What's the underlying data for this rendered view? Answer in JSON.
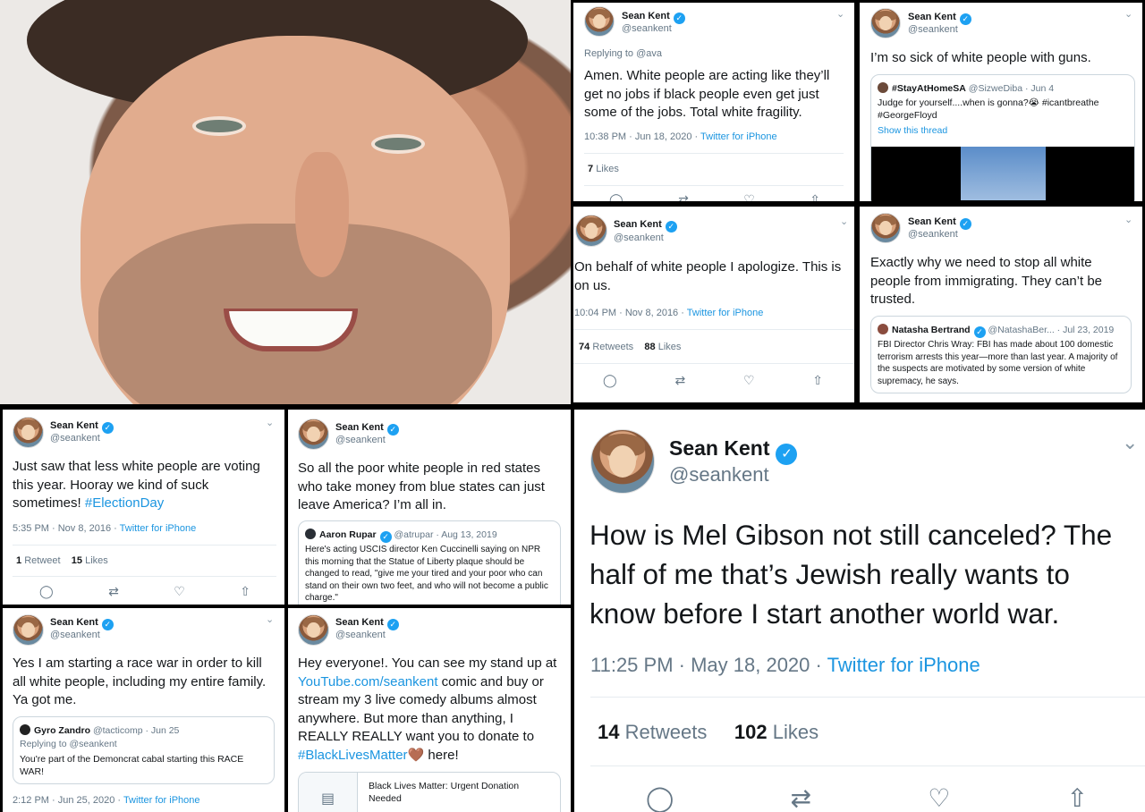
{
  "photo": {
    "alt_icon": "portrait-photo"
  },
  "t1": {
    "name": "Sean Kent",
    "handle": "@seankent",
    "reply": "Replying to @ava",
    "text": "Amen. White people are acting like they’ll get no jobs if black people even get just some of the jobs. Total white fragility.",
    "time": "10:38 PM · Jun 18, 2020 · ",
    "source": "Twitter for iPhone",
    "likes_num": "7",
    "likes_label": "Likes"
  },
  "t2": {
    "name": "Sean Kent",
    "handle": "@seankent",
    "text": "I’m so sick of white people with guns.",
    "quote": {
      "name": "#StayAtHomeSA",
      "handle": "@SizweDiba · Jun 4",
      "text": "Judge for yourself....when is gonna?😭 #icantbreathe #GeorgeFloyd",
      "show": "Show this thread"
    }
  },
  "t3": {
    "name": "Sean Kent",
    "handle": "@seankent",
    "text": "On behalf of white people I apologize. This is on us.",
    "time": "10:04 PM · Nov 8, 2016 · ",
    "source": "Twitter for iPhone",
    "rt_num": "74",
    "rt_label": "Retweets",
    "likes_num": "88",
    "likes_label": "Likes"
  },
  "t4": {
    "name": "Sean Kent",
    "handle": "@seankent",
    "text": "Exactly why we need to stop all white people from immigrating. They can’t be trusted.",
    "quote": {
      "name": "Natasha Bertrand",
      "handle": "@NatashaBer... · Jul 23, 2019",
      "text": "FBI Director Chris Wray: FBI has made about 100 domestic terrorism arrests this year—more than last year. A majority of the suspects are motivated by some version of white supremacy, he says."
    }
  },
  "t5": {
    "name": "Sean Kent",
    "handle": "@seankent",
    "text": "Just saw that less white people are voting this year. Hooray we kind of suck sometimes! ",
    "hashtag": "#ElectionDay",
    "time": "5:35 PM · Nov 8, 2016 · ",
    "source": "Twitter for iPhone",
    "rt_num": "1",
    "rt_label": "Retweet",
    "likes_num": "15",
    "likes_label": "Likes"
  },
  "t6": {
    "name": "Sean Kent",
    "handle": "@seankent",
    "text": "So all the poor white people in red states who take money from blue states can just leave America? I’m all in.",
    "quote": {
      "name": "Aaron Rupar",
      "handle": "@atrupar · Aug 13, 2019",
      "text": "Here's acting USCIS director Ken Cuccinelli saying on NPR this morning that the Statue of Liberty plaque should be changed to read, \"give me your tired and your poor who can stand on their own two feet, and who will not become a public charge.\""
    }
  },
  "t7": {
    "name": "Sean Kent",
    "handle": "@seankent",
    "text": "How is Mel Gibson not still canceled? The half of me that’s Jewish really wants to know before I start another world war.",
    "time": "11:25 PM · May 18, 2020 · ",
    "source": "Twitter for iPhone",
    "rt_num": "14",
    "rt_label": "Retweets",
    "likes_num": "102",
    "likes_label": "Likes"
  },
  "t8": {
    "name": "Sean Kent",
    "handle": "@seankent",
    "text": "Yes I am starting a race war in order to kill all white people, including my entire family. Ya got me.",
    "quote": {
      "name": "Gyro Zandro",
      "handle": "@tacticomp · Jun 25",
      "reply": "Replying to @seankent",
      "text": "You're part of the Demoncrat cabal starting this RACE WAR!"
    },
    "time": "2:12 PM · Jun 25, 2020 · ",
    "source": "Twitter for iPhone"
  },
  "t9": {
    "name": "Sean Kent",
    "handle": "@seankent",
    "text_a": "Hey everyone!. You can see my stand up at ",
    "link": "YouTube.com/seankent",
    "text_b": " comic and buy or stream my 3 live comedy albums almost anywhere. But more than anything, I REALLY REALLY want you to donate to ",
    "hashtag": "#BlackLivesMatter",
    "emoji": "🤎",
    "text_c": " here!",
    "card": "Black Lives Matter: Urgent Donation Needed"
  },
  "icons": {
    "reply": "reply-icon",
    "retweet": "retweet-icon",
    "like": "heart-icon",
    "share": "share-icon"
  },
  "colors": {
    "link": "#1b95e0",
    "verified": "#1da1f2",
    "secondary": "#657786"
  }
}
